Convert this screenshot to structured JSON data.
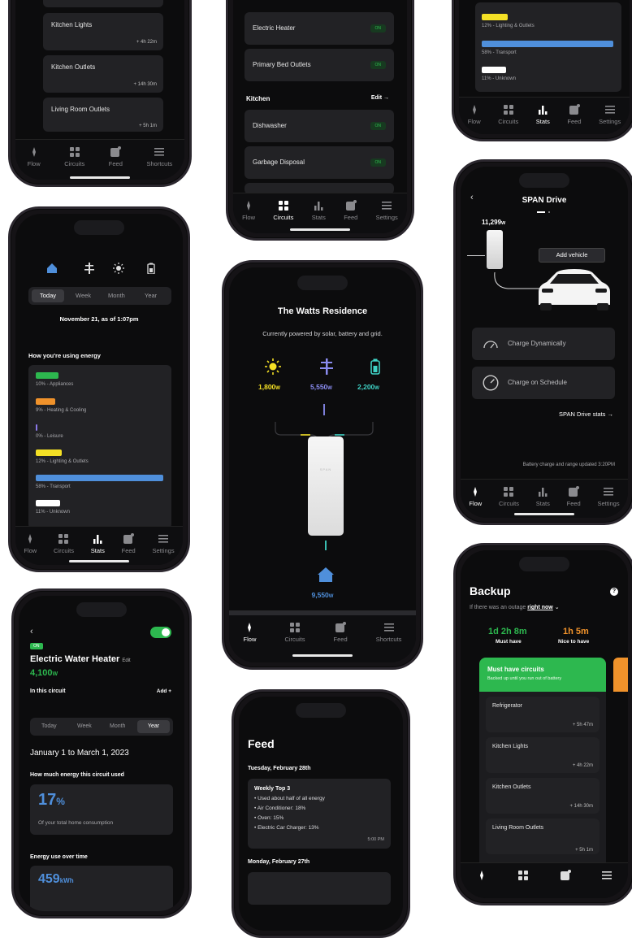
{
  "nav": {
    "flow": "Flow",
    "circuits": "Circuits",
    "stats": "Stats",
    "feed": "Feed",
    "settings": "Settings",
    "shortcuts": "Shortcuts"
  },
  "phone1": {
    "rows": [
      {
        "name": "Kitchen Lights",
        "time": "+ 4h 22m"
      },
      {
        "name": "Kitchen Outlets",
        "time": "+ 14h 30m"
      },
      {
        "name": "Living Room Outlets",
        "time": "+ 5h 1m"
      }
    ]
  },
  "phone2": {
    "rows_top": [
      {
        "name": "Electric Heater",
        "state": "ON"
      },
      {
        "name": "Primary Bed Outlets",
        "state": "ON"
      }
    ],
    "section": "Kitchen",
    "edit": "Edit →",
    "rows_bottom": [
      {
        "name": "Dishwasher",
        "state": "ON"
      },
      {
        "name": "Garbage Disposal",
        "state": "ON"
      }
    ]
  },
  "phone3": {
    "bars": [
      {
        "label": "12% - Lighting & Outlets",
        "color": "#f4e025",
        "value": 0.12
      },
      {
        "label": "58% - Transport",
        "color": "#4f8fdb",
        "value": 0.58
      },
      {
        "label": "11% - Unknown",
        "color": "#ffffff",
        "value": 0.11
      }
    ]
  },
  "phone4": {
    "tabs": [
      "Today",
      "Week",
      "Month",
      "Year"
    ],
    "date": "November 21, as of 1:07pm",
    "heading": "How you're using energy",
    "bars": [
      {
        "label": "10% - Appliances",
        "color": "#2db84f",
        "value": 0.1
      },
      {
        "label": "9% - Heating & Cooling",
        "color": "#f0922b",
        "value": 0.09
      },
      {
        "label": "0% - Leisure",
        "color": "#8a78e8",
        "value": 0.0
      },
      {
        "label": "12% - Lighting & Outlets",
        "color": "#f4e025",
        "value": 0.12
      },
      {
        "label": "58% - Transport",
        "color": "#4f8fdb",
        "value": 0.58
      },
      {
        "label": "11% - Unknown",
        "color": "#ffffff",
        "value": 0.11
      }
    ]
  },
  "phone5": {
    "title": "The Watts Residence",
    "subtitle": "Currently powered by solar, battery and grid.",
    "solar": "1,800",
    "grid": "5,550",
    "battery": "2,200",
    "home": "9,550",
    "unit": "W",
    "panel_brand": "SPAN"
  },
  "phone6": {
    "title": "SPAN Drive",
    "watts": "11,299",
    "unit": "W",
    "add_vehicle": "Add vehicle",
    "opt1": "Charge Dynamically",
    "opt2": "Charge on Schedule",
    "stats_link": "SPAN Drive stats →",
    "footer": "Battery charge and range updated 3:20PM"
  },
  "phone7": {
    "toggle": "ON",
    "title": "Electric Water Heater",
    "edit": "Edit",
    "watts": "4,100",
    "unit": "W",
    "in_circuit": "In this circuit",
    "add": "Add +",
    "tabs": [
      "Today",
      "Week",
      "Month",
      "Year"
    ],
    "range": "January 1 to March 1, 2023",
    "used_heading": "How much energy this circuit used",
    "pct": "17",
    "pct_sign": "%",
    "pct_sub": "Of your total home consumption",
    "over_time": "Energy use over time",
    "kwh": "459",
    "kwh_unit": "kWh"
  },
  "phone8": {
    "title": "Feed",
    "date1": "Tuesday, February 28th",
    "card_title": "Weekly Top 3",
    "bullets": [
      "• Used about half of all energy",
      "• Air Conditioner: 18%",
      "• Oven: 15%",
      "• Electric Car Charger: 13%"
    ],
    "time": "5:00 PM",
    "date2": "Monday, February 27th"
  },
  "phone9": {
    "title": "Backup",
    "outage_prefix": "If there was an outage",
    "outage_link": "right now",
    "must_value": "1d 2h 8m",
    "must_label": "Must have",
    "nice_value": "1h 5m",
    "nice_label": "Nice to have",
    "card_title": "Must have circuits",
    "card_sub": "Backed up until you run out of battery",
    "rows": [
      {
        "name": "Refrigerator",
        "time": "+ 5h 47m"
      },
      {
        "name": "Kitchen Lights",
        "time": "+ 4h 22m"
      },
      {
        "name": "Kitchen Outlets",
        "time": "+ 14h 30m"
      },
      {
        "name": "Living Room Outlets",
        "time": "+ 5h 1m"
      }
    ]
  }
}
